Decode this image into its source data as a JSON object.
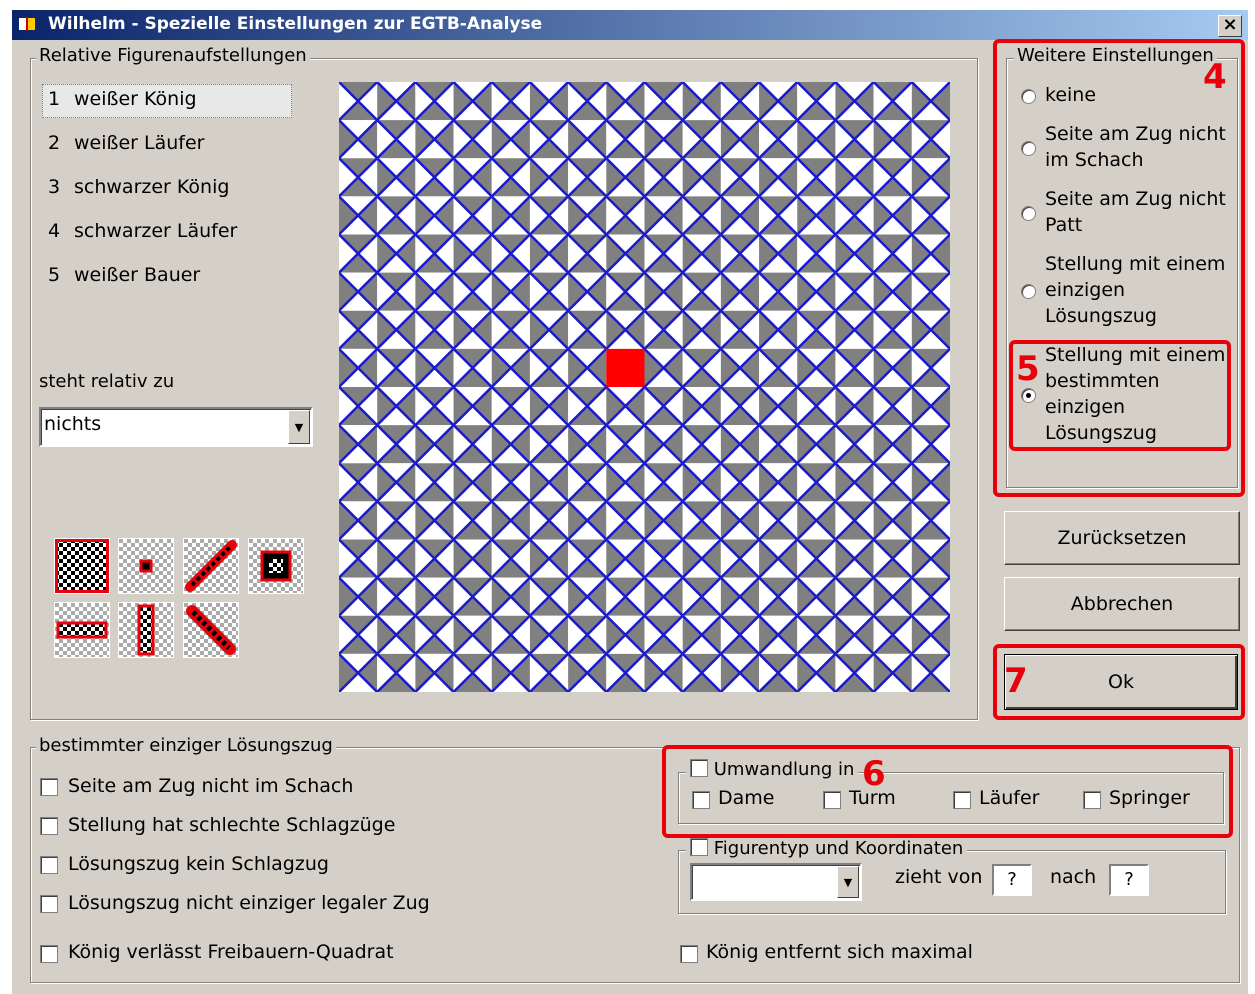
{
  "window": {
    "title": "Wilhelm - Spezielle Einstellungen zur EGTB-Analyse",
    "close": "×"
  },
  "relative": {
    "legend": "Relative Figurenaufstellungen",
    "items": [
      {
        "num": "1",
        "label": "weißer König"
      },
      {
        "num": "2",
        "label": "weißer Läufer"
      },
      {
        "num": "3",
        "label": "schwarzer König"
      },
      {
        "num": "4",
        "label": "schwarzer Läufer"
      },
      {
        "num": "5",
        "label": "weißer Bauer"
      }
    ],
    "relative_label": "steht relativ zu",
    "relative_value": "nichts",
    "combo_arrow": "▼"
  },
  "weitere": {
    "legend": "Weitere Einstellungen",
    "options": [
      {
        "lines": [
          "keine"
        ],
        "selected": false
      },
      {
        "lines": [
          "Seite am Zug nicht",
          "im Schach"
        ],
        "selected": false
      },
      {
        "lines": [
          "Seite am Zug nicht",
          "Patt"
        ],
        "selected": false
      },
      {
        "lines": [
          "Stellung mit einem",
          "einzigen",
          "Lösungszug"
        ],
        "selected": false
      },
      {
        "lines": [
          "Stellung mit einem",
          "bestimmten",
          "einzigen",
          "Lösungszug"
        ],
        "selected": true
      }
    ]
  },
  "buttons": {
    "reset": "Zurücksetzen",
    "cancel": "Abbrechen",
    "ok": "Ok"
  },
  "bestimmt": {
    "legend": "bestimmter einziger Lösungszug",
    "checks": [
      "Seite am Zug nicht im Schach",
      "Stellung hat schlechte Schlagzüge",
      "Lösungszug kein Schlagzug",
      "Lösungszug nicht einziger legaler Zug"
    ],
    "king_leaves": "König verlässt Freibauern-Quadrat",
    "king_distance": "König entfernt sich maximal",
    "umwandlung": {
      "label": "Umwandlung in",
      "pieces": [
        "Dame",
        "Turm",
        "Läufer",
        "Springer"
      ]
    },
    "figurentyp": {
      "label": "Figurentyp und Koordinaten",
      "zieht_von": "zieht von",
      "von_value": "?",
      "nach": "nach",
      "nach_value": "?"
    }
  },
  "annotations": [
    "4",
    "5",
    "6",
    "7"
  ],
  "colors": {
    "highlight": "#e8000a",
    "board_blue": "#1a1acc",
    "board_gray": "#808080",
    "target_square": "#ff0000"
  },
  "board": {
    "rows": 16,
    "cols": 16,
    "target_row": 7,
    "target_col": 7
  }
}
